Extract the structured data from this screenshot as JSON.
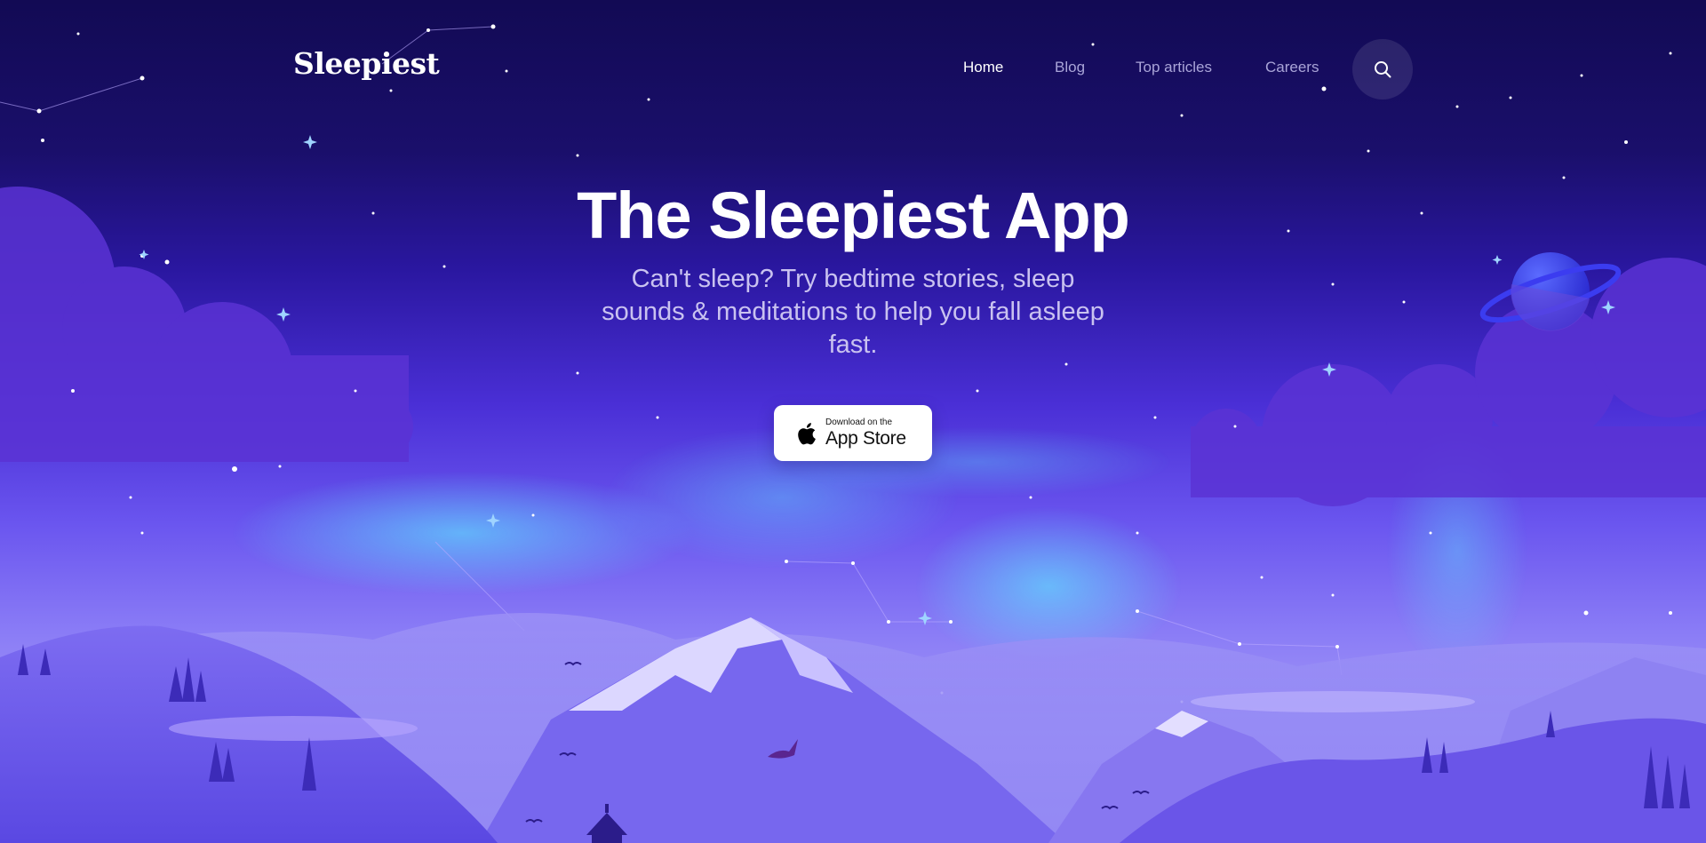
{
  "brand": {
    "logo_text": "Sleepiest"
  },
  "nav": {
    "items": [
      {
        "label": "Home",
        "active": true
      },
      {
        "label": "Blog",
        "active": false
      },
      {
        "label": "Top articles",
        "active": false
      },
      {
        "label": "Careers",
        "active": false
      }
    ],
    "search_icon": "search-icon"
  },
  "hero": {
    "title": "The Sleepiest App",
    "subtitle": "Can't sleep? Try bedtime stories, sleep sounds & meditations to help you fall asleep fast.",
    "cta": {
      "small_text": "Download on the",
      "big_text": "App Store",
      "icon": "apple-icon"
    }
  },
  "colors": {
    "sky_top": "#120a54",
    "sky_mid": "#4a2fd6",
    "sky_bottom": "#b7aef8",
    "nav_active": "#ffffff",
    "nav_inactive": "#a9a4d8",
    "aurora": "#4fd3f5",
    "planet": "#3b3cf0"
  }
}
